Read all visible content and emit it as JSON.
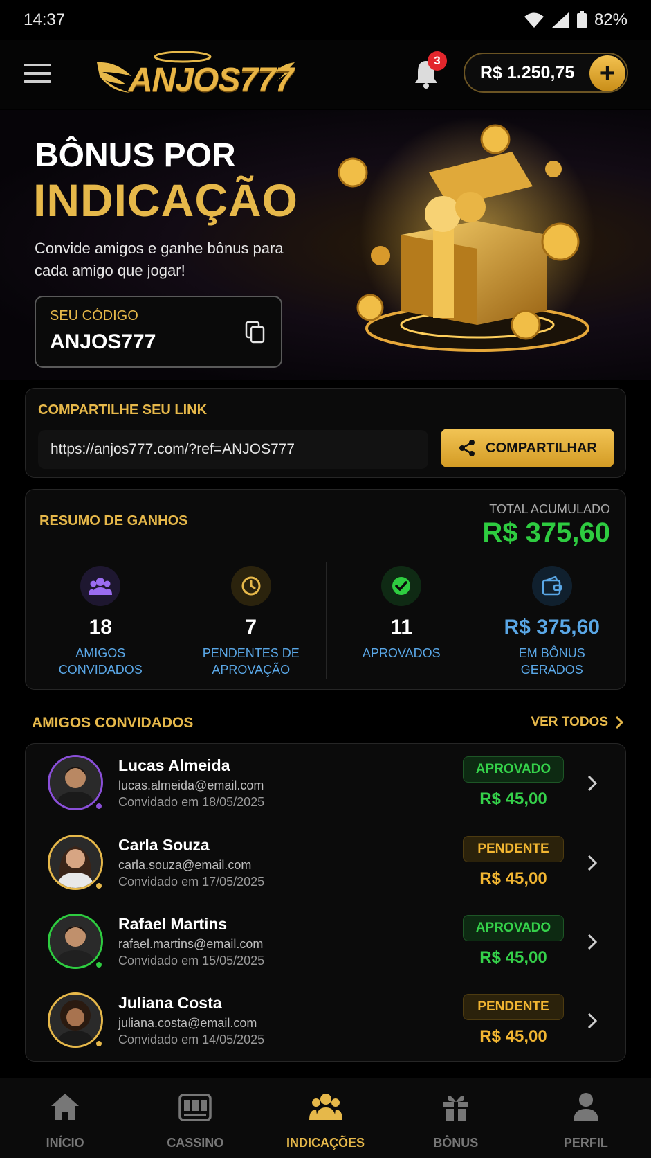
{
  "status_bar": {
    "time": "14:37",
    "battery": "82%"
  },
  "header": {
    "logo_text": "ANJOS777",
    "notifications_count": "3",
    "balance": "R$ 1.250,75",
    "add_label": "+"
  },
  "hero": {
    "title_line1": "BÔNUS POR",
    "title_line2": "INDICAÇÃO",
    "subtitle": "Convide amigos e ganhe bônus para cada amigo que jogar!",
    "code_label": "SEU CÓDIGO",
    "code_value": "ANJOS777"
  },
  "share": {
    "heading": "COMPARTILHE SEU LINK",
    "url": "https://anjos777.com/?ref=ANJOS777",
    "button_label": "COMPARTILHAR"
  },
  "summary": {
    "heading": "RESUMO DE GANHOS",
    "total_label": "TOTAL ACUMULADO",
    "total_value": "R$ 375,60",
    "stats": [
      {
        "icon": "users-icon",
        "value": "18",
        "label": "AMIGOS CONVIDADOS"
      },
      {
        "icon": "clock-icon",
        "value": "7",
        "label": "PENDENTES DE APROVAÇÃO"
      },
      {
        "icon": "check-icon",
        "value": "11",
        "label": "APROVADOS"
      },
      {
        "icon": "wallet-icon",
        "value": "R$ 375,60",
        "label": "EM BÔNUS GERADOS"
      }
    ]
  },
  "friends": {
    "heading": "AMIGOS CONVIDADOS",
    "see_all": "VER TODOS",
    "items": [
      {
        "name": "Lucas Almeida",
        "email": "lucas.almeida@email.com",
        "date": "Convidado em 18/05/2025",
        "status": "APROVADO",
        "amount": "R$ 45,00",
        "ring": "#8a4fd8"
      },
      {
        "name": "Carla Souza",
        "email": "carla.souza@email.com",
        "date": "Convidado em 17/05/2025",
        "status": "PENDENTE",
        "amount": "R$ 45,00",
        "ring": "#e6b84a"
      },
      {
        "name": "Rafael Martins",
        "email": "rafael.martins@email.com",
        "date": "Convidado em 15/05/2025",
        "status": "APROVADO",
        "amount": "R$ 45,00",
        "ring": "#2ecc40"
      },
      {
        "name": "Juliana Costa",
        "email": "juliana.costa@email.com",
        "date": "Convidado em 14/05/2025",
        "status": "PENDENTE",
        "amount": "R$ 45,00",
        "ring": "#e6b84a"
      }
    ]
  },
  "nav": {
    "items": [
      {
        "label": "INÍCIO",
        "icon": "home-icon"
      },
      {
        "label": "CASSINO",
        "icon": "slot-machine-icon"
      },
      {
        "label": "INDICAÇÕES",
        "icon": "group-icon"
      },
      {
        "label": "BÔNUS",
        "icon": "gift-icon"
      },
      {
        "label": "PERFIL",
        "icon": "profile-icon"
      }
    ],
    "active": "INDICAÇÕES"
  },
  "colors": {
    "accent_gold": "#e6b84a",
    "success_green": "#2ecc40",
    "info_blue": "#5aa7e6",
    "badge_red": "#e3262c"
  }
}
